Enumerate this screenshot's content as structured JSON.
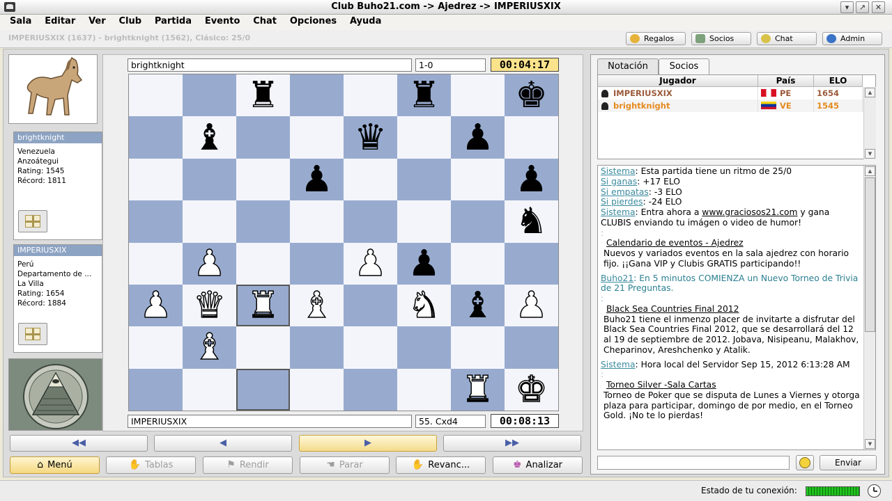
{
  "window": {
    "title": "Club Buho21.com -> Ajedrez -> IMPERIUSXIX"
  },
  "menu": [
    "Sala",
    "Editar",
    "Ver",
    "Club",
    "Partida",
    "Evento",
    "Chat",
    "Opciones",
    "Ayuda"
  ],
  "toolbar": {
    "game_info": "IMPERIUSXIX (1637) - brightknight (1562), Clásico: 25/0",
    "buttons": [
      "Regalos",
      "Socios",
      "Chat",
      "Admin"
    ]
  },
  "top_player": {
    "name": "brightknight",
    "country": "Venezuela",
    "region": "Anzoátegui",
    "rating": "Rating: 1545",
    "record": "Récord: 1811",
    "score": "1-0",
    "clock": "00:04:17"
  },
  "bottom_player": {
    "name": "IMPERIUSXIX",
    "country": "Perú",
    "region": "Departamento de ...",
    "city": "La Villa",
    "rating": "Rating: 1654",
    "record": "Récord: 1884",
    "last_move": "55. Cxd4",
    "clock": "00:08:13"
  },
  "board": {
    "rows": [
      [
        "",
        "",
        "br",
        "",
        "",
        "br",
        "",
        "bk"
      ],
      [
        "",
        "bb",
        "",
        "",
        "bq",
        "",
        "bp",
        ""
      ],
      [
        "",
        "",
        "",
        "bp",
        "",
        "",
        "",
        "bp"
      ],
      [
        "",
        "",
        "",
        "",
        "",
        "",
        "",
        "bn"
      ],
      [
        "",
        "wp",
        "",
        "",
        "wp",
        "bp",
        "",
        ""
      ],
      [
        "wp",
        "wq",
        "wr",
        "wb",
        "",
        "wn",
        "bb",
        "wp"
      ],
      [
        "",
        "wb",
        "",
        "",
        "",
        "",
        "",
        ""
      ],
      [
        "",
        "",
        "",
        "",
        "",
        "",
        "wr",
        "wk"
      ]
    ],
    "highlight": [
      "5-2",
      "7-2"
    ],
    "colors": {
      "light": "#f4f5fb",
      "dark": "#98abcf"
    }
  },
  "nav": [
    "◀◀",
    "◀",
    "▶",
    "▶▶"
  ],
  "actions": [
    {
      "label": "Menú",
      "icon": "⌂",
      "disabled": false
    },
    {
      "label": "Tablas",
      "icon": "✋",
      "disabled": true
    },
    {
      "label": "Rendir",
      "icon": "⚑",
      "disabled": true
    },
    {
      "label": "Parar",
      "icon": "☚",
      "disabled": true
    },
    {
      "label": "Revanc...",
      "icon": "✋",
      "disabled": false
    },
    {
      "label": "Analizar",
      "icon": "♚",
      "disabled": false
    }
  ],
  "tabs": [
    "Notación",
    "Socios"
  ],
  "players_table": {
    "headers": [
      "Jugador",
      "País",
      "ELO"
    ],
    "rows": [
      {
        "name": "IMPERIUSXIX",
        "country": "PE",
        "elo": "1654",
        "color": "#9a5a3a"
      },
      {
        "name": "brightknight",
        "country": "VE",
        "elo": "1545",
        "color": "#e58a1f"
      }
    ]
  },
  "chat": {
    "line1_label": "Sistema",
    "line1_text": ": Esta partida tiene un ritmo de 25/0",
    "win_label": "Si ganas",
    "win_text": ": +17 ELO",
    "draw_label": "Si empatas",
    "draw_text": ": -3 ELO",
    "lose_label": "Si pierdes",
    "lose_text": ": -24 ELO",
    "promo_label": "Sistema",
    "promo_text1": ": Entra ahora a ",
    "promo_link": "www.graciosos21.com",
    "promo_text2": " y gana CLUBIS enviando tu imágen o video de humor!",
    "cal_title": "Calendario de eventos - Ajedrez",
    "cal_text": "Nuevos y variados eventos en la sala ajedrez con horario fijo. ¡¡Gana VIP y Clubis GRATIS participando!!",
    "buho_label": "Buho21",
    "buho_text": ": En 5 minutos COMIENZA un Nuevo Torneo de Trivia de 21 Preguntas.",
    "bs_title": "Black Sea Countries Final 2012",
    "bs_text": "Buho21 tiene el inmenzo placer de invitarte a disfrutar del Black Sea Countries Final 2012, que se desarrollará del 12 al 19 de septiembre de 2012. Jobava, Nisipeanu, Malakhov, Cheparinov, Areshchenko y Atalik.",
    "time_label": "Sistema",
    "time_text": ": Hora local del Servidor Sep 15, 2012 6:13:28 AM",
    "torneo_title": "Torneo  Silver -Sala Cartas",
    "torneo_text": "Torneo de Poker que se disputa de Lunes a Viernes y otorga  plaza para participar, domingo de por medio, en  el Torneo Gold. ¡No te lo pierdas!"
  },
  "send_label": "Enviar",
  "status": {
    "label": "Estado de tu conexión:"
  }
}
